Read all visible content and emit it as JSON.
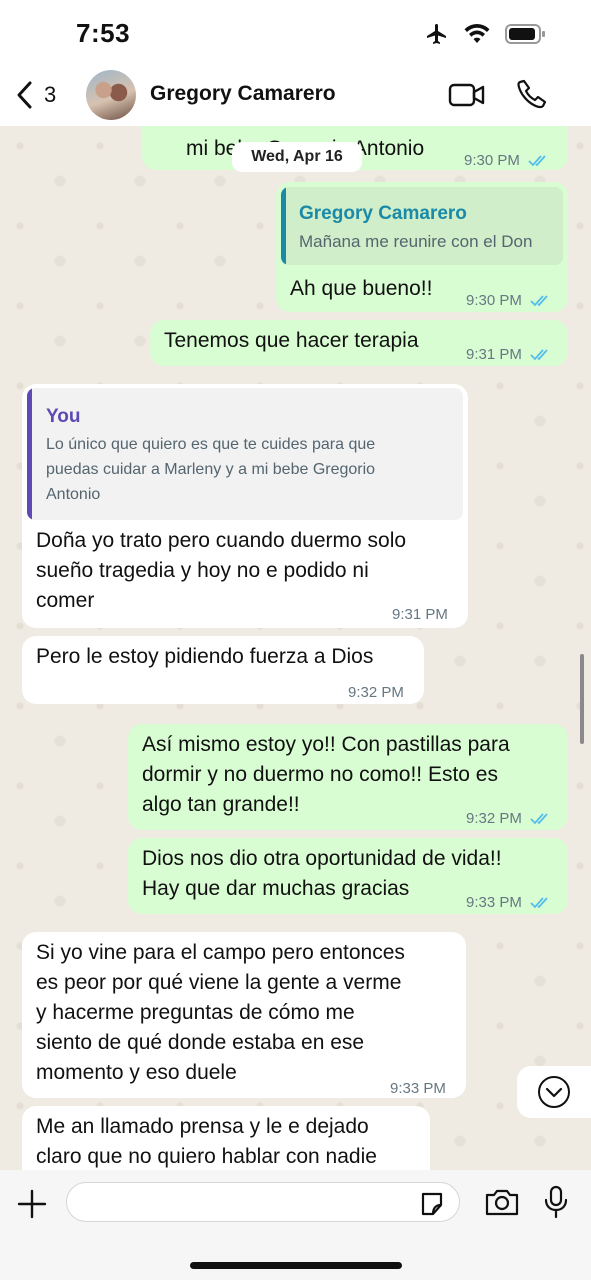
{
  "status": {
    "time": "7:53"
  },
  "header": {
    "back_count": "3",
    "contact_name": "Gregory Camarero"
  },
  "chat": {
    "date_separator": "Wed, Apr 16",
    "partial_top": {
      "text": "mi bebe Gregorio Antonio",
      "time": "9:30 PM"
    },
    "reply1": {
      "quote_author": "Gregory Camarero",
      "quote_text": "Mañana me reunire con el Don",
      "text": "Ah que bueno!!",
      "time": "9:30 PM"
    },
    "msg_terapia": {
      "text": "Tenemos que hacer terapia",
      "time": "9:31 PM"
    },
    "reply2": {
      "quote_author": "You",
      "quote_text": "Lo único que quiero es que te cuides para que\npuedas cuidar a Marleny y a mi bebe Gregorio\nAntonio",
      "text": "Doña yo trato pero cuando duermo solo\nsueño tragedia y hoy no e podido ni\ncomer",
      "time": "9:31 PM"
    },
    "msg_dios": {
      "text": "Pero le estoy pidiendo fuerza a Dios",
      "time": "9:32 PM"
    },
    "msg_asi": {
      "text": "Así mismo estoy yo!! Con pastillas para\ndormir y no duermo no como!! Esto es\nalgo tan grande!!",
      "time": "9:32 PM"
    },
    "msg_oportunidad": {
      "text": "Dios nos dio otra oportunidad de vida!!\nHay que dar muchas gracias",
      "time": "9:33 PM"
    },
    "msg_campo": {
      "text": "Si yo vine para el campo pero entonces\nes peor por qué viene la gente a verme\ny hacerme preguntas de cómo me\nsiento de qué donde estaba en ese\nmomento y eso duele",
      "time": "9:33 PM"
    },
    "msg_prensa": {
      "text": "Me an llamado prensa y le e dejado\nclaro que no quiero hablar con nadie"
    }
  },
  "input": {
    "value": "",
    "placeholder": ""
  },
  "colors": {
    "outgoing": "#d9fdd3",
    "incoming": "#ffffff",
    "read_tick": "#53bdeb",
    "quote_self": "#5f4ab4",
    "quote_contact": "#1a8aa8"
  },
  "icons": [
    "back-chevron-icon",
    "video-call-icon",
    "phone-icon",
    "scroll-down-icon",
    "plus-icon",
    "sticker-icon",
    "camera-icon",
    "microphone-icon",
    "airplane-icon",
    "wifi-icon",
    "battery-icon",
    "double-check-icon"
  ]
}
